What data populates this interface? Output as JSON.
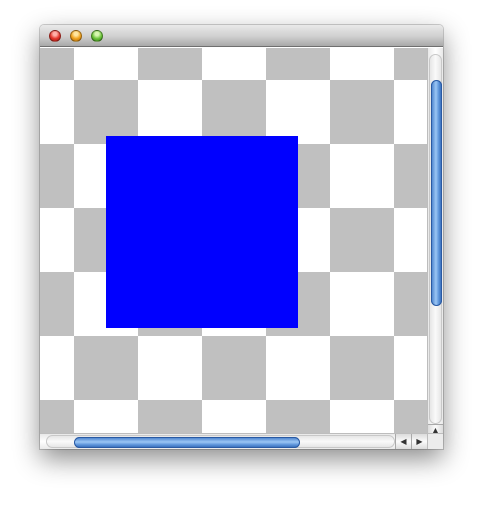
{
  "window": {
    "title": ""
  },
  "icons": {
    "close": "close-icon",
    "minimize": "minimize-icon",
    "zoom": "zoom-icon",
    "scroll_up": "arrow-up-icon",
    "scroll_down": "arrow-down-icon",
    "scroll_left": "arrow-left-icon",
    "scroll_right": "arrow-right-icon"
  },
  "glyphs": {
    "up": "▲",
    "down": "▼",
    "left": "◀",
    "right": "▶"
  },
  "canvas": {
    "checker_light": "#ffffff",
    "checker_dark": "#c0c0c0",
    "shape_color": "#0000ff",
    "shape": "filled-square"
  },
  "scroll": {
    "vertical_position": 0.0,
    "horizontal_position": 0.0
  },
  "colors": {
    "scroll_thumb": "#5d95db",
    "close": "#e2352b",
    "minimize": "#f0a21e",
    "zoom": "#6cc43a"
  }
}
